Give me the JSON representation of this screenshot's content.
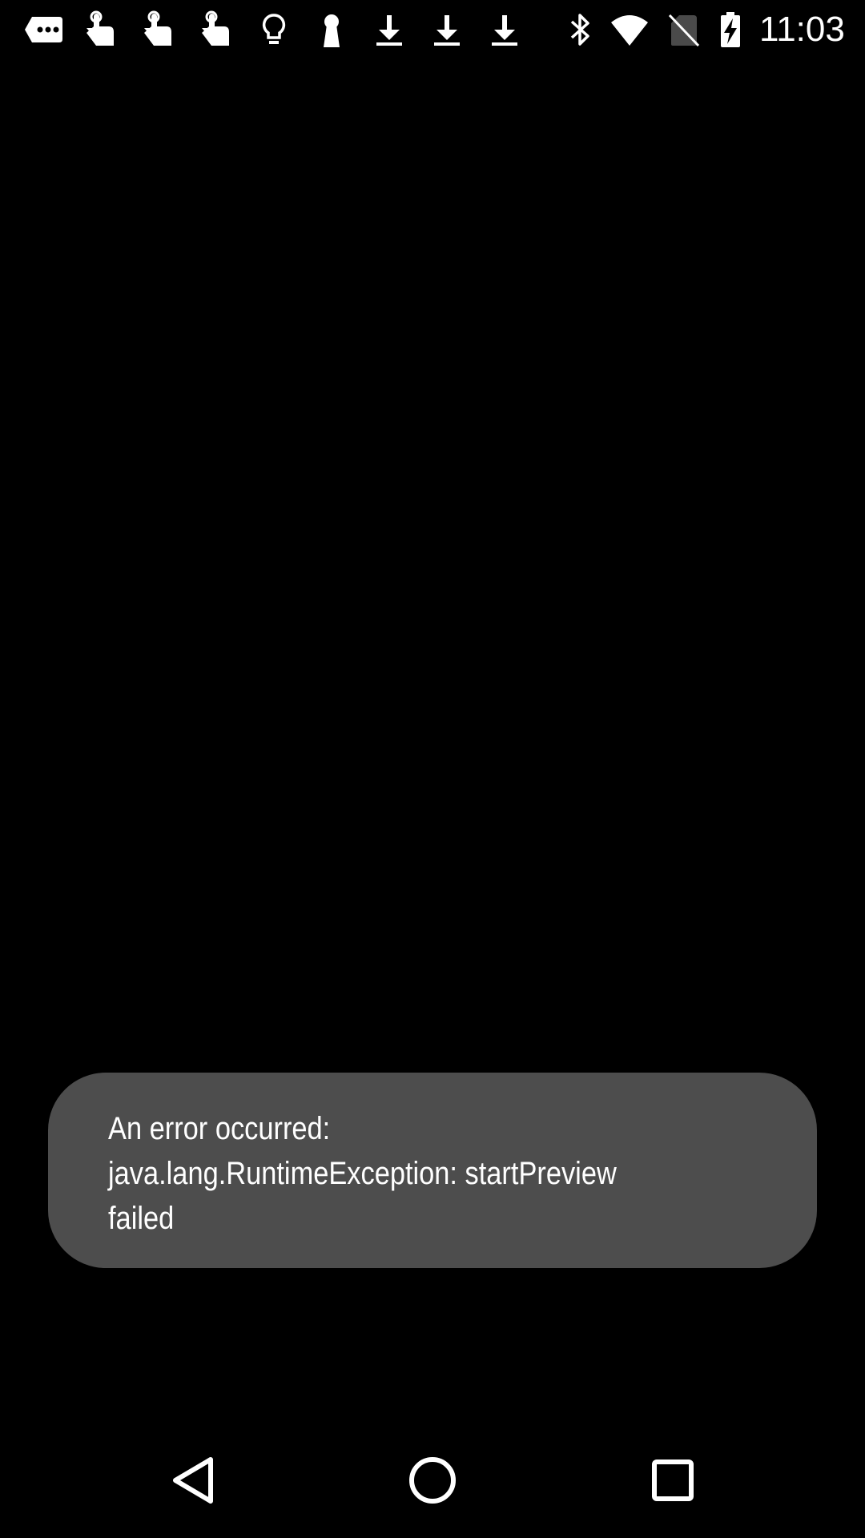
{
  "status_bar": {
    "time": "11:03",
    "notification_icons": [
      "more-notifications-icon",
      "touch-app-icon",
      "touch-app-icon",
      "touch-app-icon",
      "lightbulb-icon",
      "keyhole-icon",
      "download-icon",
      "download-icon",
      "download-icon"
    ],
    "system_icons": [
      "bluetooth-icon",
      "wifi-icon",
      "no-sim-icon",
      "battery-charging-icon"
    ]
  },
  "toast": {
    "message": "An error occurred:\njava.lang.RuntimeException: startPreview\nfailed"
  },
  "navigation": {
    "buttons": [
      "back-icon",
      "home-icon",
      "recents-icon"
    ]
  },
  "colors": {
    "background": "#000000",
    "toast_background": "#4d4d4d",
    "text": "#ffffff"
  }
}
